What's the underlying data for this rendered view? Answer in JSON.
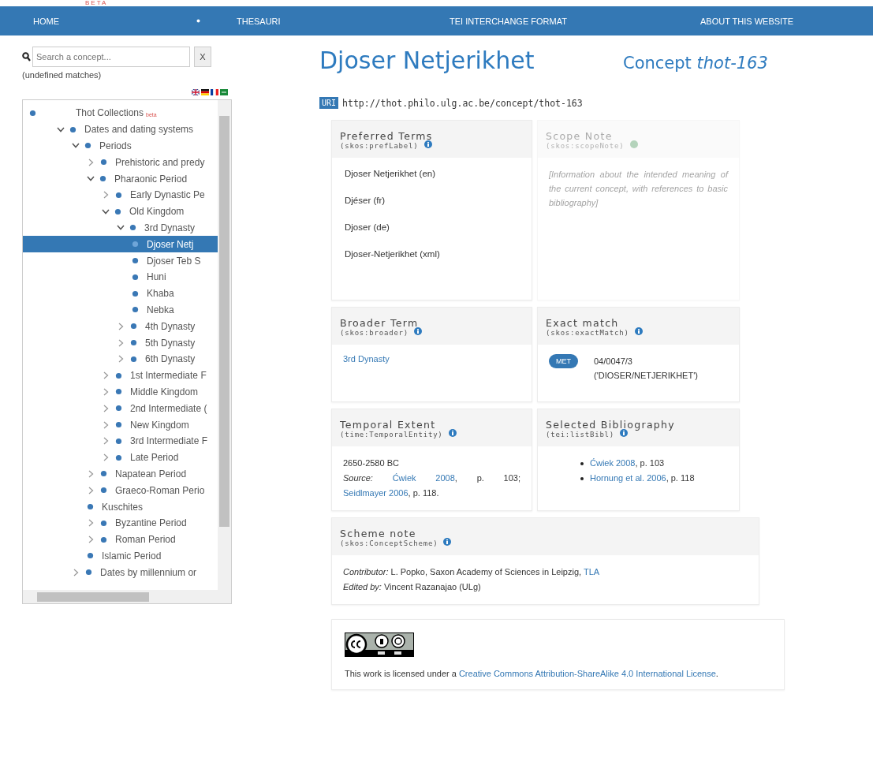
{
  "brand_tag": "BETA",
  "nav": [
    {
      "label": "HOME",
      "has_menu": true
    },
    {
      "label": "THESAURI",
      "has_menu": false
    },
    {
      "label": "TEI INTERCHANGE FORMAT",
      "has_menu": false
    },
    {
      "label": "ABOUT THIS WEBSITE",
      "has_menu": false
    }
  ],
  "search": {
    "placeholder": "Search a concept...",
    "clear_label": "X",
    "matches": "(undefined matches)"
  },
  "languages": [
    {
      "kind": "uk"
    },
    {
      "kind": "de"
    },
    {
      "kind": "fr"
    },
    {
      "kind": "ar"
    }
  ],
  "tree": [
    {
      "label": "Thot Collections",
      "tag": "beta",
      "kind": "root",
      "selected": false,
      "children": [
        {
          "label": "Dates and dating systems",
          "kind": "branch",
          "selected": false,
          "expanded": true,
          "children": [
            {
              "label": "Periods",
              "kind": "branch",
              "selected": false,
              "expanded": true,
              "children": [
                {
                  "label": "Prehistoric and predy",
                  "kind": "branch",
                  "selected": false,
                  "expanded": false
                },
                {
                  "label": "Pharaonic Period",
                  "kind": "branch",
                  "selected": false,
                  "expanded": true,
                  "children": [
                    {
                      "label": "Early Dynastic Pe",
                      "kind": "branch",
                      "selected": false,
                      "expanded": false
                    },
                    {
                      "label": "Old Kingdom",
                      "kind": "branch",
                      "selected": false,
                      "expanded": true,
                      "children": [
                        {
                          "label": "3rd Dynasty",
                          "kind": "branch",
                          "selected": false,
                          "expanded": true,
                          "children": [
                            {
                              "label": "Djoser Netj",
                              "kind": "leaf",
                              "selected": true
                            },
                            {
                              "label": "Djoser Teb S",
                              "kind": "leaf",
                              "selected": false
                            },
                            {
                              "label": "Huni",
                              "kind": "leaf",
                              "selected": false
                            },
                            {
                              "label": "Khaba",
                              "kind": "leaf",
                              "selected": false
                            },
                            {
                              "label": "Nebka",
                              "kind": "leaf",
                              "selected": false
                            }
                          ]
                        },
                        {
                          "label": "4th Dynasty",
                          "kind": "branch",
                          "selected": false,
                          "expanded": false
                        },
                        {
                          "label": "5th Dynasty",
                          "kind": "branch",
                          "selected": false,
                          "expanded": false
                        },
                        {
                          "label": "6th Dynasty",
                          "kind": "branch",
                          "selected": false,
                          "expanded": false
                        }
                      ]
                    },
                    {
                      "label": "1st Intermediate F",
                      "kind": "branch",
                      "selected": false,
                      "expanded": false
                    },
                    {
                      "label": "Middle Kingdom",
                      "kind": "branch",
                      "selected": false,
                      "expanded": false
                    },
                    {
                      "label": "2nd Intermediate (",
                      "kind": "branch",
                      "selected": false,
                      "expanded": false
                    },
                    {
                      "label": "New Kingdom",
                      "kind": "branch",
                      "selected": false,
                      "expanded": false
                    },
                    {
                      "label": "3rd Intermediate F",
                      "kind": "branch",
                      "selected": false,
                      "expanded": false
                    },
                    {
                      "label": "Late Period",
                      "kind": "branch",
                      "selected": false,
                      "expanded": false
                    }
                  ]
                },
                {
                  "label": "Napatean Period",
                  "kind": "branch",
                  "selected": false,
                  "expanded": false
                },
                {
                  "label": "Graeco-Roman Perio",
                  "kind": "branch",
                  "selected": false,
                  "expanded": false
                },
                {
                  "label": "Kuschites",
                  "kind": "leaf",
                  "selected": false
                },
                {
                  "label": "Byzantine Period",
                  "kind": "branch",
                  "selected": false,
                  "expanded": false
                },
                {
                  "label": "Roman Period",
                  "kind": "branch",
                  "selected": false,
                  "expanded": false
                },
                {
                  "label": "Islamic Period",
                  "kind": "leaf",
                  "selected": false
                }
              ]
            },
            {
              "label": "Dates by millennium or",
              "kind": "branch",
              "selected": false,
              "expanded": false
            }
          ]
        }
      ]
    }
  ],
  "title": "Djoser Netjerikhet",
  "concept": "Concept *thot-163*",
  "uri": {
    "badge": "URI",
    "value": "http://thot.philo.ulg.ac.be/concept/thot-163"
  },
  "preferred_terms": {
    "title": "Preferred Terms",
    "property": "(skos:prefLabel)",
    "terms": [
      "Djoser Netjerikhet (en)",
      "Djéser (fr)",
      "Djoser (de)",
      "Djoser-Netjerikhet (xml)"
    ]
  },
  "scope_note": {
    "title": "Scope Note",
    "property": "(skos:scopeNote)",
    "text": "[Information about the intended meaning of the current concept, with references to basic bibliography]",
    "faded": true
  },
  "broader_term": {
    "title": "Broader Term",
    "property": "(skos:broader)",
    "link": "3rd Dynasty"
  },
  "exact_match": {
    "title": "Exact match",
    "property": "(skos:exactMatch)",
    "badge": "MET",
    "value": "04/0047/3 ('DIOSER/NETJERIKHET')"
  },
  "temporal_extent": {
    "title": "Temporal Extent",
    "property": "(time:TemporalEntity)",
    "range": "2650-2580 BC",
    "source_label": "Source:",
    "sources": [
      {
        "link": "Ćwiek 2008",
        "suffix": ", p. 103;"
      },
      {
        "link": "Seidlmayer 2006",
        "suffix": ", p. 118."
      }
    ]
  },
  "bibliography": {
    "title": "Selected Bibliography",
    "property": "(tei:listBibl)",
    "items": [
      {
        "link": "Ćwiek 2008",
        "suffix": ", p. 103"
      },
      {
        "link": "Hornung et al. 2006",
        "suffix": ", p. 118"
      }
    ]
  },
  "scheme_note": {
    "title": "Scheme note",
    "property": "(skos:ConceptScheme)",
    "contributor_label": "Contributor:",
    "contributor": " L. Popko, Saxon Academy of Sciences in Leipzig, ",
    "contributor_link": "TLA",
    "editor_label": "Edited by:",
    "editor": " Vincent Razanajao (ULg)"
  },
  "license": {
    "text": "This work is licensed under a ",
    "link": "Creative Commons Attribution-ShareAlike 4.0 International License",
    "end": "."
  }
}
